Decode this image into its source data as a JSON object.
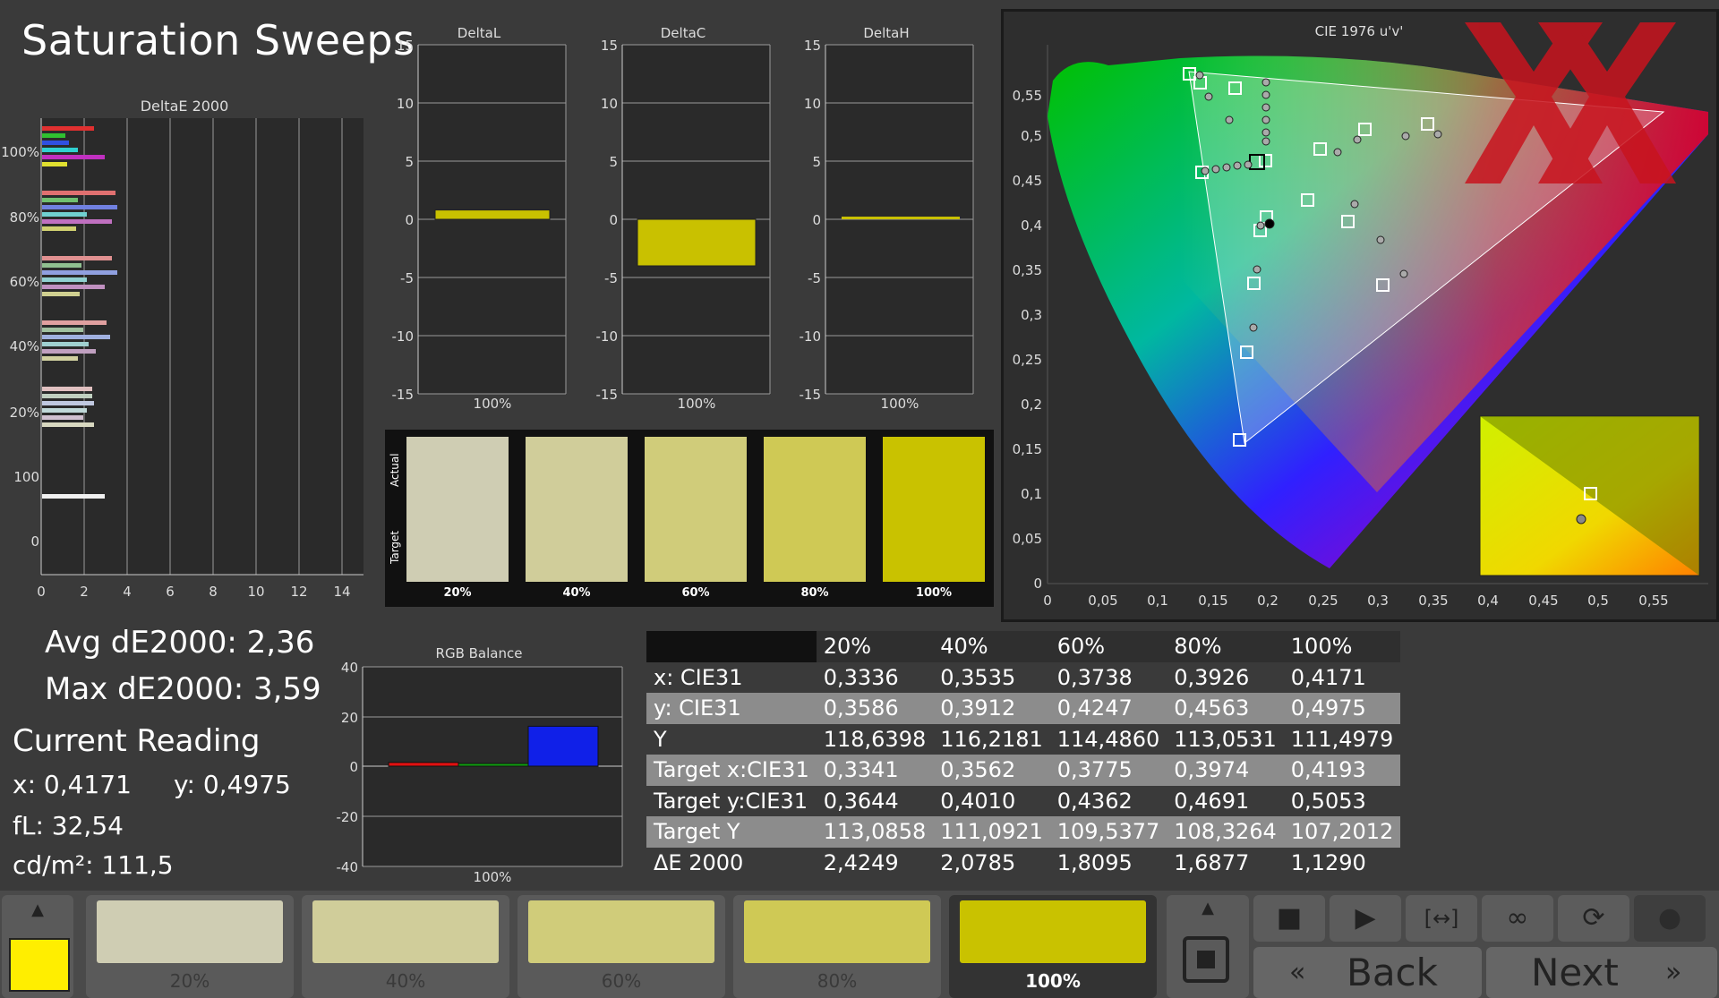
{
  "app": {
    "title": "Saturation Sweeps"
  },
  "colors": {
    "accent_yellow": "#c9c100",
    "cursor_yellow": "#ffee00",
    "panel_dark": "#2a2a2a",
    "watermark_red": "#c8141e"
  },
  "deltaE_chart": {
    "title": "DeltaE 2000",
    "x_ticks": [
      "0",
      "2",
      "4",
      "6",
      "8",
      "10",
      "12",
      "14"
    ],
    "y_ticks": [
      "100%",
      "80%",
      "60%",
      "40%",
      "20%",
      "100",
      "0"
    ]
  },
  "delta_charts": [
    {
      "title": "DeltaL",
      "x_label": "100%",
      "y_ticks": [
        "15",
        "10",
        "5",
        "0",
        "-5",
        "-10",
        "-15"
      ]
    },
    {
      "title": "DeltaC",
      "x_label": "100%",
      "y_ticks": [
        "15",
        "10",
        "5",
        "0",
        "-5",
        "-10",
        "-15"
      ]
    },
    {
      "title": "DeltaH",
      "x_label": "100%",
      "y_ticks": [
        "15",
        "10",
        "5",
        "0",
        "-5",
        "-10",
        "-15"
      ]
    }
  ],
  "swatch_panel": {
    "actual_label": "Actual",
    "target_label": "Target",
    "labels": [
      "20%",
      "40%",
      "60%",
      "80%",
      "100%"
    ]
  },
  "cie": {
    "title": "CIE 1976 u'v'",
    "x_ticks": [
      "0",
      "0,05",
      "0,1",
      "0,15",
      "0,2",
      "0,25",
      "0,3",
      "0,35",
      "0,4",
      "0,45",
      "0,5",
      "0,55"
    ],
    "y_ticks": [
      "0",
      "0,05",
      "0,1",
      "0,15",
      "0,2",
      "0,25",
      "0,3",
      "0,35",
      "0,4",
      "0,45",
      "0,5",
      "0,55"
    ]
  },
  "stats": {
    "avg": "Avg dE2000: 2,36",
    "max": "Max dE2000: 3,59",
    "current_reading": "Current Reading",
    "x": "x: 0,4171",
    "y": "y: 0,4975",
    "fl": "fL: 32,54",
    "cd": "cd/m²: 111,5"
  },
  "rgb_balance": {
    "title": "RGB Balance",
    "x_label": "100%",
    "y_ticks": [
      "40",
      "20",
      "0",
      "-20",
      "-40"
    ]
  },
  "table": {
    "headers": [
      "",
      "20%",
      "40%",
      "60%",
      "80%",
      "100%"
    ],
    "rows": [
      [
        "x: CIE31",
        "0,3336",
        "0,3535",
        "0,3738",
        "0,3926",
        "0,4171"
      ],
      [
        "y: CIE31",
        "0,3586",
        "0,3912",
        "0,4247",
        "0,4563",
        "0,4975"
      ],
      [
        "Y",
        "118,6398",
        "116,2181",
        "114,4860",
        "113,0531",
        "111,4979"
      ],
      [
        "Target x:CIE31",
        "0,3341",
        "0,3562",
        "0,3775",
        "0,3974",
        "0,4193"
      ],
      [
        "Target y:CIE31",
        "0,3644",
        "0,4010",
        "0,4362",
        "0,4691",
        "0,5053"
      ],
      [
        "Target Y",
        "113,0858",
        "111,0921",
        "109,5377",
        "108,3264",
        "107,2012"
      ],
      [
        "ΔE 2000",
        "2,4249",
        "2,0785",
        "1,8095",
        "1,6877",
        "1,1290"
      ]
    ]
  },
  "bottom": {
    "tiles": [
      "20%",
      "40%",
      "60%",
      "80%",
      "100%"
    ],
    "back": "Back",
    "next": "Next"
  },
  "chart_data": [
    {
      "type": "bar",
      "title": "DeltaL",
      "categories": [
        "100%"
      ],
      "values": [
        0.8
      ],
      "ylim": [
        -15,
        15
      ]
    },
    {
      "type": "bar",
      "title": "DeltaC",
      "categories": [
        "100%"
      ],
      "values": [
        -4
      ],
      "ylim": [
        -15,
        15
      ]
    },
    {
      "type": "bar",
      "title": "DeltaH",
      "categories": [
        "100%"
      ],
      "values": [
        0
      ],
      "ylim": [
        -15,
        15
      ]
    },
    {
      "type": "bar",
      "title": "RGB Balance",
      "categories": [
        "100%"
      ],
      "series": [
        {
          "values": [
            1.5
          ]
        },
        {
          "values": [
            0.3
          ]
        },
        {
          "values": [
            16
          ]
        }
      ],
      "ylim": [
        -40,
        40
      ]
    }
  ]
}
